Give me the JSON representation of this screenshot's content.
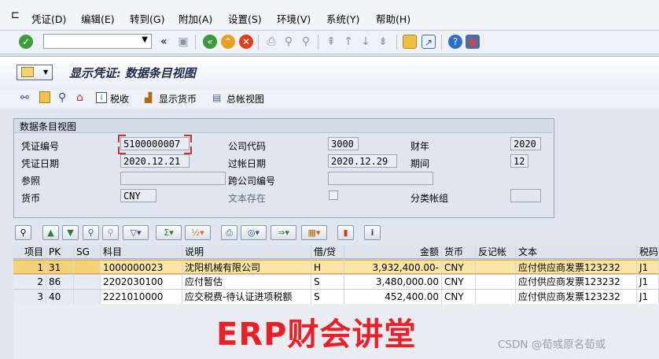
{
  "menu": [
    "凭证(D)",
    "编辑(E)",
    "转到(G)",
    "附加(A)",
    "设置(S)",
    "环境(V)",
    "系统(Y)",
    "帮助(H)"
  ],
  "systoolbar": {
    "command_field": ""
  },
  "title": "显示凭证: 数据条目视图",
  "apptoolbar": {
    "tax": "税收",
    "display_currency": "显示货币",
    "ledger_view": "总帐视图"
  },
  "header_section": {
    "title": "数据条目视图",
    "doc_no_label": "凭证编号",
    "doc_no": "5100000007",
    "company_label": "公司代码",
    "company": "3000",
    "fiscal_year_label": "财年",
    "fiscal_year": "2020",
    "doc_date_label": "凭证日期",
    "doc_date": "2020.12.21",
    "posting_date_label": "过帐日期",
    "posting_date": "2020.12.29",
    "period_label": "期间",
    "period": "12",
    "reference_label": "参照",
    "reference": "",
    "cross_company_label": "跨公司编号",
    "cross_company": "",
    "currency_label": "货币",
    "currency": "CNY",
    "text_exists_label": "文本存在",
    "ledger_group_label": "分类帐组",
    "ledger_group": ""
  },
  "table": {
    "columns": [
      "项目",
      "PK",
      "SG",
      "科目",
      "说明",
      "借/贷",
      "金额",
      "货币",
      "反记帐",
      "文本",
      "税码"
    ],
    "rows": [
      {
        "item": "1",
        "pk": "31",
        "sg": "",
        "account": "1000000023",
        "desc": "沈阳机械有限公司",
        "dc": "H",
        "amount": "3,932,400.00-",
        "curr": "CNY",
        "reverse": "",
        "text": "应付供应商发票123232",
        "tax": "J1"
      },
      {
        "item": "2",
        "pk": "86",
        "sg": "",
        "account": "2202030100",
        "desc": "应付暂估",
        "dc": "S",
        "amount": "3,480,000.00",
        "curr": "CNY",
        "reverse": "",
        "text": "应付供应商发票123232",
        "tax": "J1"
      },
      {
        "item": "3",
        "pk": "40",
        "sg": "",
        "account": "2221010000",
        "desc": "应交税费-待认证进项税额",
        "dc": "S",
        "amount": "452,400.00",
        "curr": "CNY",
        "reverse": "",
        "text": "应付供应商发票123232",
        "tax": "J1"
      }
    ]
  },
  "watermark": "ERP财会讲堂",
  "credit": "CSDN @荀彧原名荀或"
}
